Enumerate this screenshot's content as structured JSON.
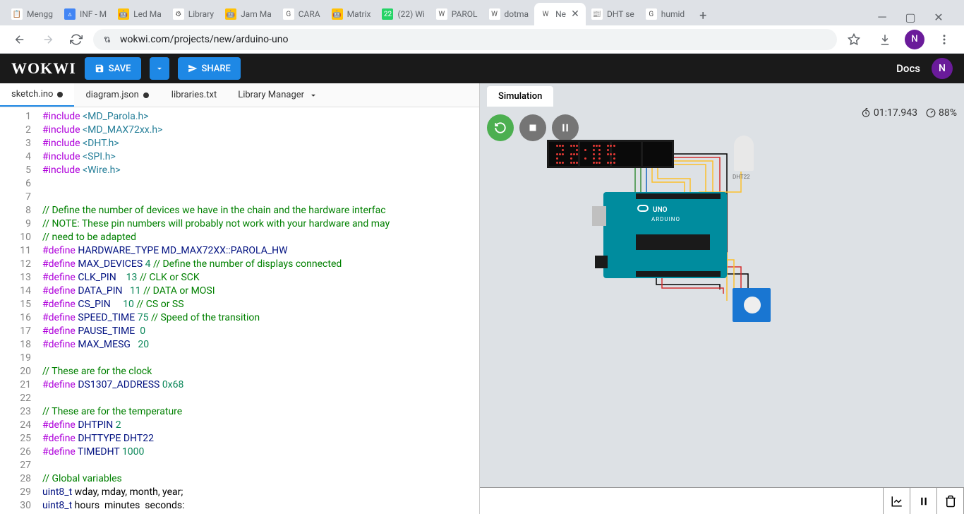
{
  "browser": {
    "tabs": [
      {
        "title": "Mengg",
        "favicon": "📋",
        "bg": "#fff"
      },
      {
        "title": "INF - M",
        "favicon": "▵",
        "bg": "#4285f4"
      },
      {
        "title": "Led Ma",
        "favicon": "🤖",
        "bg": "#ffc107"
      },
      {
        "title": "Library",
        "favicon": "⚙",
        "bg": "#fff"
      },
      {
        "title": "Jam Ma",
        "favicon": "🤖",
        "bg": "#ffc107"
      },
      {
        "title": "CARA",
        "favicon": "G",
        "bg": "#fff"
      },
      {
        "title": "Matrix",
        "favicon": "🤖",
        "bg": "#ffc107"
      },
      {
        "title": "(22) Wi",
        "favicon": "22",
        "bg": "#25d366"
      },
      {
        "title": "PAROL",
        "favicon": "W",
        "bg": "#fff"
      },
      {
        "title": "dotma",
        "favicon": "W",
        "bg": "#fff"
      },
      {
        "title": "Ne",
        "favicon": "W",
        "bg": "#fff",
        "active": true
      },
      {
        "title": "DHT se",
        "favicon": "📰",
        "bg": "#fff"
      },
      {
        "title": "humid",
        "favicon": "G",
        "bg": "#fff"
      }
    ],
    "url": "wokwi.com/projects/new/arduino-uno",
    "avatar": "N"
  },
  "wokwi": {
    "logo": "WOKWI",
    "save": "SAVE",
    "share": "SHARE",
    "docs": "Docs",
    "avatar": "N"
  },
  "editor": {
    "tabs": [
      {
        "label": "sketch.ino",
        "modified": true,
        "active": true
      },
      {
        "label": "diagram.json",
        "modified": true
      },
      {
        "label": "libraries.txt"
      }
    ],
    "libmgr": "Library Manager",
    "lines": [
      [
        {
          "t": "#include",
          "c": "kw"
        },
        {
          "t": " "
        },
        {
          "t": "<MD_Parola.h>",
          "c": "inc"
        }
      ],
      [
        {
          "t": "#include",
          "c": "kw"
        },
        {
          "t": " "
        },
        {
          "t": "<MD_MAX72xx.h>",
          "c": "inc"
        }
      ],
      [
        {
          "t": "#include",
          "c": "kw"
        },
        {
          "t": " "
        },
        {
          "t": "<DHT.h>",
          "c": "inc"
        }
      ],
      [
        {
          "t": "#include",
          "c": "kw"
        },
        {
          "t": " "
        },
        {
          "t": "<SPI.h>",
          "c": "inc"
        }
      ],
      [
        {
          "t": "#include",
          "c": "kw"
        },
        {
          "t": " "
        },
        {
          "t": "<Wire.h>",
          "c": "inc"
        }
      ],
      [],
      [],
      [
        {
          "t": "// Define the number of devices we have in the chain and the hardware interfac",
          "c": "cmt"
        }
      ],
      [
        {
          "t": "// NOTE: These pin numbers will probably not work with your hardware and may",
          "c": "cmt"
        }
      ],
      [
        {
          "t": "// need to be adapted",
          "c": "cmt"
        }
      ],
      [
        {
          "t": "#define",
          "c": "kw"
        },
        {
          "t": " HARDWARE_TYPE MD_MAX72XX::PAROLA_HW",
          "c": "id"
        }
      ],
      [
        {
          "t": "#define",
          "c": "kw"
        },
        {
          "t": " MAX_DEVICES ",
          "c": "id"
        },
        {
          "t": "4",
          "c": "num"
        },
        {
          "t": " "
        },
        {
          "t": "// Define the number of displays connected",
          "c": "cmt"
        }
      ],
      [
        {
          "t": "#define",
          "c": "kw"
        },
        {
          "t": " CLK_PIN    ",
          "c": "id"
        },
        {
          "t": "13",
          "c": "num"
        },
        {
          "t": " "
        },
        {
          "t": "// CLK or SCK",
          "c": "cmt"
        }
      ],
      [
        {
          "t": "#define",
          "c": "kw"
        },
        {
          "t": " DATA_PIN   ",
          "c": "id"
        },
        {
          "t": "11",
          "c": "num"
        },
        {
          "t": " "
        },
        {
          "t": "// DATA or MOSI",
          "c": "cmt"
        }
      ],
      [
        {
          "t": "#define",
          "c": "kw"
        },
        {
          "t": " CS_PIN     ",
          "c": "id"
        },
        {
          "t": "10",
          "c": "num"
        },
        {
          "t": " "
        },
        {
          "t": "// CS or SS",
          "c": "cmt"
        }
      ],
      [
        {
          "t": "#define",
          "c": "kw"
        },
        {
          "t": " SPEED_TIME ",
          "c": "id"
        },
        {
          "t": "75",
          "c": "num"
        },
        {
          "t": " "
        },
        {
          "t": "// Speed of the transition",
          "c": "cmt"
        }
      ],
      [
        {
          "t": "#define",
          "c": "kw"
        },
        {
          "t": " PAUSE_TIME  ",
          "c": "id"
        },
        {
          "t": "0",
          "c": "num"
        }
      ],
      [
        {
          "t": "#define",
          "c": "kw"
        },
        {
          "t": " MAX_MESG   ",
          "c": "id"
        },
        {
          "t": "20",
          "c": "num"
        }
      ],
      [],
      [
        {
          "t": "// These are for the clock",
          "c": "cmt"
        }
      ],
      [
        {
          "t": "#define",
          "c": "kw"
        },
        {
          "t": " DS1307_ADDRESS ",
          "c": "id"
        },
        {
          "t": "0x68",
          "c": "num"
        }
      ],
      [],
      [
        {
          "t": "// These are for the temperature",
          "c": "cmt"
        }
      ],
      [
        {
          "t": "#define",
          "c": "kw"
        },
        {
          "t": " DHTPIN ",
          "c": "id"
        },
        {
          "t": "2",
          "c": "num"
        }
      ],
      [
        {
          "t": "#define",
          "c": "kw"
        },
        {
          "t": " DHTTYPE DHT22",
          "c": "id"
        }
      ],
      [
        {
          "t": "#define",
          "c": "kw"
        },
        {
          "t": " TIMEDHT ",
          "c": "id"
        },
        {
          "t": "1000",
          "c": "num"
        }
      ],
      [],
      [
        {
          "t": "// Global variables",
          "c": "cmt"
        }
      ],
      [
        {
          "t": "uint8_t",
          "c": "id"
        },
        {
          "t": " wday, mday, month, year;"
        }
      ],
      [
        {
          "t": "uint8_t",
          "c": "id"
        },
        {
          "t": " hours  minutes  seconds:"
        }
      ]
    ]
  },
  "sim": {
    "tab": "Simulation",
    "time": "01:17.943",
    "perf": "88%",
    "arduino_label": "UNO",
    "arduino_brand": "ARDUINO",
    "dht_label": "DHT22",
    "matrix_display": "22:05"
  }
}
